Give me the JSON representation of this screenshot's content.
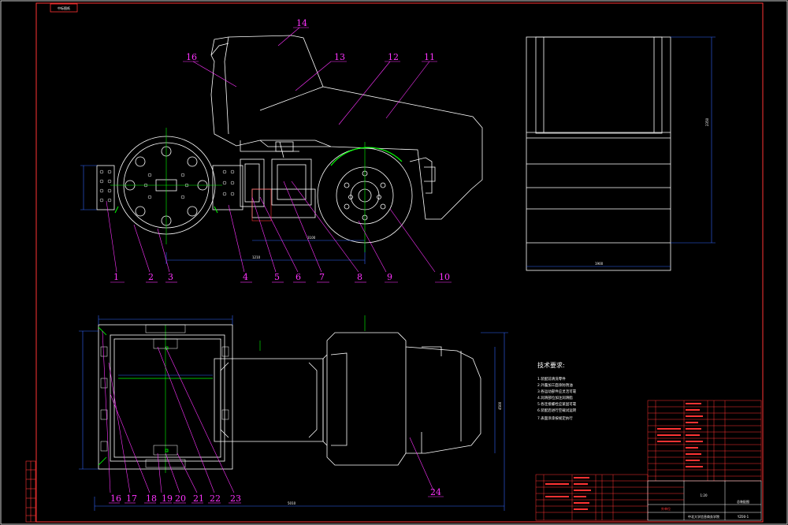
{
  "stamp": "中标图纸",
  "part_labels": [
    {
      "n": "1"
    },
    {
      "n": "2"
    },
    {
      "n": "3"
    },
    {
      "n": "4"
    },
    {
      "n": "5"
    },
    {
      "n": "6"
    },
    {
      "n": "7"
    },
    {
      "n": "8"
    },
    {
      "n": "9"
    },
    {
      "n": "10"
    },
    {
      "n": "11"
    },
    {
      "n": "12"
    },
    {
      "n": "13"
    },
    {
      "n": "14"
    },
    {
      "n": "16"
    },
    {
      "n": "16"
    },
    {
      "n": "17"
    },
    {
      "n": "18"
    },
    {
      "n": "19"
    },
    {
      "n": "20"
    },
    {
      "n": "21"
    },
    {
      "n": "22"
    },
    {
      "n": "23"
    },
    {
      "n": "24"
    }
  ],
  "tech_requirements": {
    "heading": "技术要求:",
    "items": [
      "1.装配前清洗零件",
      "2.外露加工面涂防锈油",
      "3.各运动部件应灵活可靠",
      "4.润滑部位加注润滑脂",
      "5.各连接螺栓应紧固可靠",
      "6.装配后进行空载试运转",
      "7.表面涂漆按规定执行"
    ]
  },
  "dimensions": {
    "front_width": "1210",
    "front_height": "3100",
    "side_width": "1900",
    "side_height": "2350",
    "top_width": "5010",
    "top_overall": "4500"
  },
  "title_block": {
    "drawing_title": "总装配图",
    "drawing_no": "YZ00-1",
    "scale": "1:20",
    "org": "外单位",
    "school": "中北大学信息商务学院"
  }
}
